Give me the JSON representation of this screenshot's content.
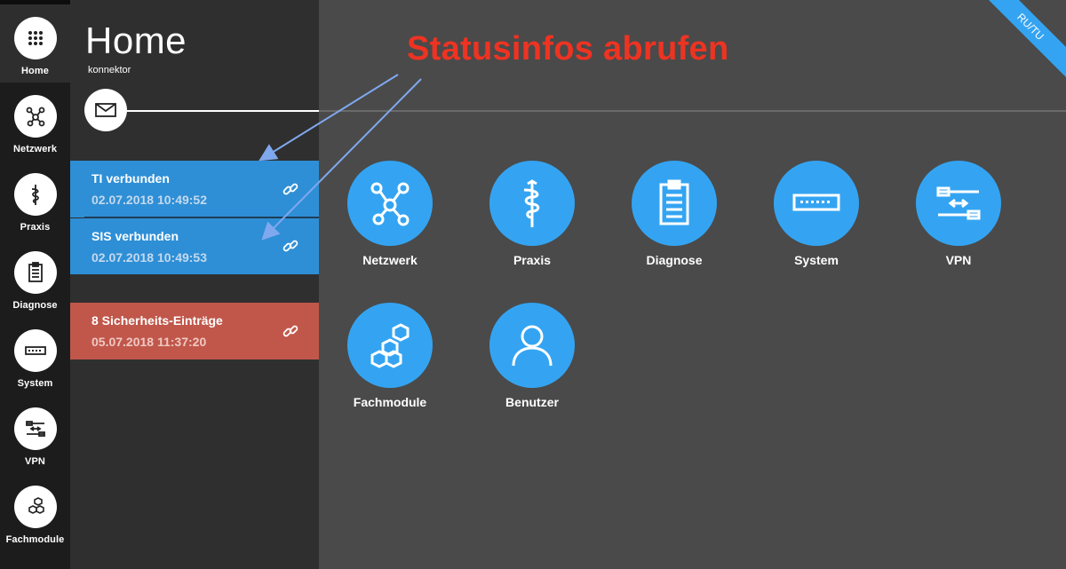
{
  "rail": {
    "items": [
      {
        "label": "Home",
        "icon": "grid-icon"
      },
      {
        "label": "Netzwerk",
        "icon": "network-icon"
      },
      {
        "label": "Praxis",
        "icon": "caduceus-icon"
      },
      {
        "label": "Diagnose",
        "icon": "clipboard-icon"
      },
      {
        "label": "System",
        "icon": "device-icon"
      },
      {
        "label": "VPN",
        "icon": "vpn-icon"
      },
      {
        "label": "Fachmodule",
        "icon": "hexagons-icon"
      }
    ]
  },
  "page": {
    "title": "Home",
    "subtitle": "konnektor"
  },
  "status": [
    {
      "title": "TI verbunden",
      "time": "02.07.2018 10:49:52",
      "color": "#2e8fd6"
    },
    {
      "title": "SIS verbunden",
      "time": "02.07.2018 10:49:53",
      "color": "#2e8fd6"
    },
    {
      "title": "8 Sicherheits-Einträge",
      "time": "05.07.2018 11:37:20",
      "color": "#c0574a"
    }
  ],
  "tiles": [
    {
      "label": "Netzwerk",
      "icon": "network-icon"
    },
    {
      "label": "Praxis",
      "icon": "caduceus-icon"
    },
    {
      "label": "Diagnose",
      "icon": "clipboard-icon"
    },
    {
      "label": "System",
      "icon": "device-icon"
    },
    {
      "label": "VPN",
      "icon": "vpn-icon"
    },
    {
      "label": "Fachmodule",
      "icon": "hexagons-icon"
    },
    {
      "label": "Benutzer",
      "icon": "user-icon"
    }
  ],
  "annotation": "Statusinfos abrufen",
  "ribbon": "RU/TU",
  "colors": {
    "accent": "#34a4f2",
    "status_ok": "#2e8fd6",
    "status_alert": "#c0574a",
    "annotation": "#ee3322"
  }
}
